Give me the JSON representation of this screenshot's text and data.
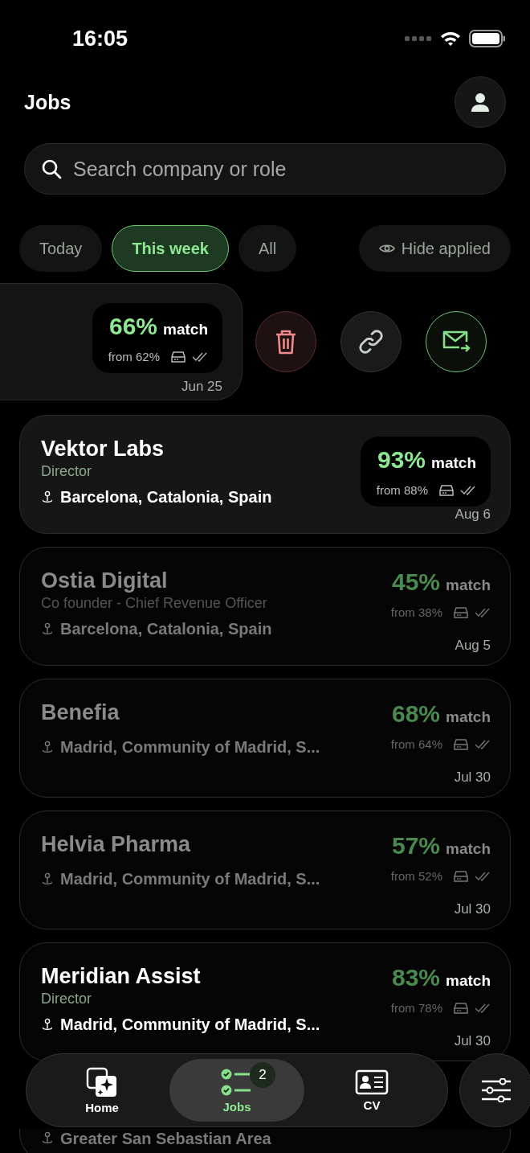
{
  "status_bar": {
    "time": "16:05"
  },
  "header": {
    "title": "Jobs"
  },
  "search": {
    "placeholder": "Search company or role"
  },
  "filters": [
    {
      "label": "Today",
      "selected": false
    },
    {
      "label": "This week",
      "selected": true
    },
    {
      "label": "All",
      "selected": false
    }
  ],
  "hide_applied": {
    "label": "Hide applied"
  },
  "swiped_card": {
    "match": {
      "percent": "66%",
      "label": "match",
      "from": "from 62%"
    },
    "date": "Jun 25",
    "actions": [
      {
        "kind": "delete"
      },
      {
        "kind": "link"
      },
      {
        "kind": "email"
      }
    ]
  },
  "jobs": [
    {
      "company": "Vektor Labs",
      "role": "Director",
      "location": "Barcelona, Catalonia, Spain",
      "match": {
        "percent": "93%",
        "label": "match",
        "from": "from 88%"
      },
      "date": "Aug 6",
      "unread": true,
      "highlighted": true
    },
    {
      "company": "Ostia Digital",
      "role": "Co founder - Chief Revenue Officer",
      "location": "Barcelona, Catalonia, Spain",
      "match": {
        "percent": "45%",
        "label": "match",
        "from": "from 38%"
      },
      "date": "Aug 5",
      "unread": false,
      "highlighted": false
    },
    {
      "company": "Benefia",
      "location": "Madrid, Community of Madrid, S...",
      "match": {
        "percent": "68%",
        "label": "match",
        "from": "from 64%"
      },
      "date": "Jul 30",
      "unread": false,
      "highlighted": false
    },
    {
      "company": "Helvia Pharma",
      "location": "Madrid, Community of Madrid, S...",
      "match": {
        "percent": "57%",
        "label": "match",
        "from": "from 52%"
      },
      "date": "Jul 30",
      "unread": false,
      "highlighted": false
    },
    {
      "company": "Meridian Assist",
      "role": "Director",
      "location": "Madrid, Community of Madrid, S...",
      "match": {
        "percent": "83%",
        "label": "match",
        "from": "from 78%"
      },
      "date": "Jul 30",
      "unread": true,
      "highlighted": false
    }
  ],
  "peek_card": {
    "location": "Greater San Sebastian Area"
  },
  "nav": [
    {
      "kind": "home",
      "label": "Home",
      "selected": false
    },
    {
      "kind": "jobs",
      "label": "Jobs",
      "selected": true,
      "badge": "2"
    },
    {
      "kind": "cv",
      "label": "CV",
      "selected": false
    }
  ]
}
